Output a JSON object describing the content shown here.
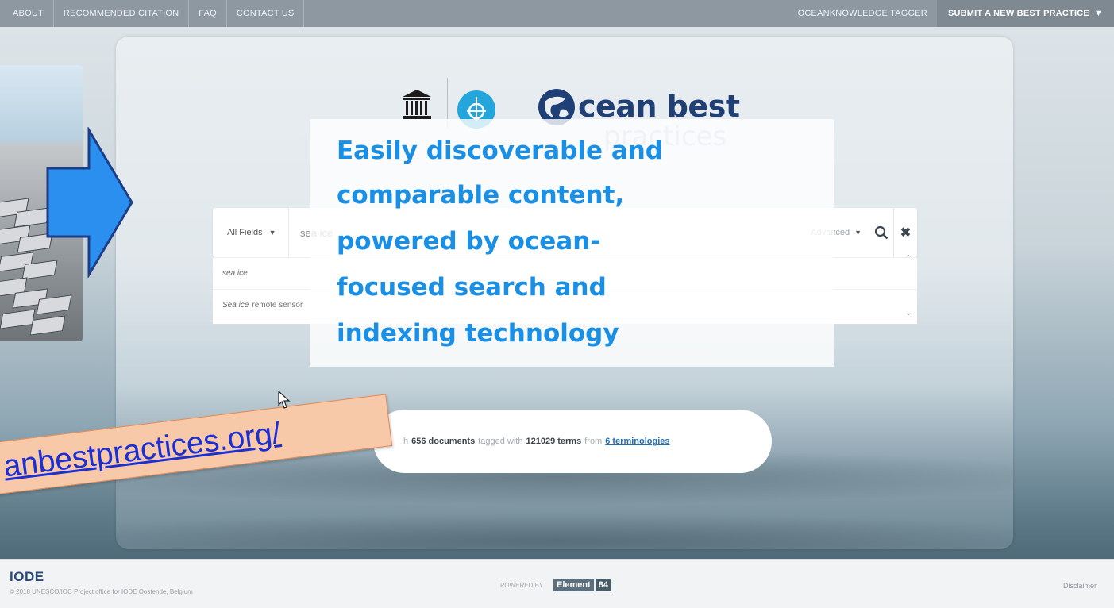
{
  "nav": {
    "left": [
      "ABOUT",
      "RECOMMENDED CITATION",
      "FAQ",
      "CONTACT US"
    ],
    "tagger": "OCEANKNOWLEDGE TAGGER",
    "submit": "SUBMIT A NEW BEST PRACTICE"
  },
  "logo": {
    "title": "cean best",
    "subtitle": "practices"
  },
  "search": {
    "field_select": "All Fields",
    "query": "sea ice",
    "advanced": "Advanced",
    "suggestions": [
      {
        "bold": "sea ice",
        "rest": ""
      },
      {
        "bold": "Sea ice",
        "rest": "remote sensor"
      }
    ]
  },
  "stats": {
    "prefix": "h",
    "docs": "656 documents",
    "tagged": "tagged with",
    "terms": "121029 terms",
    "from": "from",
    "terminologies": "6 terminologies"
  },
  "overlay": {
    "lines": [
      "Easily discoverable and",
      "comparable content,",
      "powered by ocean-",
      "focused search and",
      "indexing technology"
    ]
  },
  "url": "anbestpractices.org/",
  "footer": {
    "logo": "IODE",
    "copyright": "© 2018 UNESCO/IOC Project office for IODE Oostende, Belgium",
    "powered": "POWERED BY",
    "element": "Element",
    "element_num": "84",
    "disclaimer": "Disclaimer"
  },
  "colors": {
    "accent_blue": "#1a8fe6",
    "arrow_blue": "#2b8ff0",
    "nav_bg": "#8e98a1",
    "banner_bg": "#f8c9a8",
    "link_blue": "#1a2fd4"
  },
  "icons": [
    "unesco-icon",
    "ioc-icon",
    "globe-icon",
    "search-icon",
    "close-icon",
    "cursor-icon",
    "chevron-down-icon"
  ]
}
